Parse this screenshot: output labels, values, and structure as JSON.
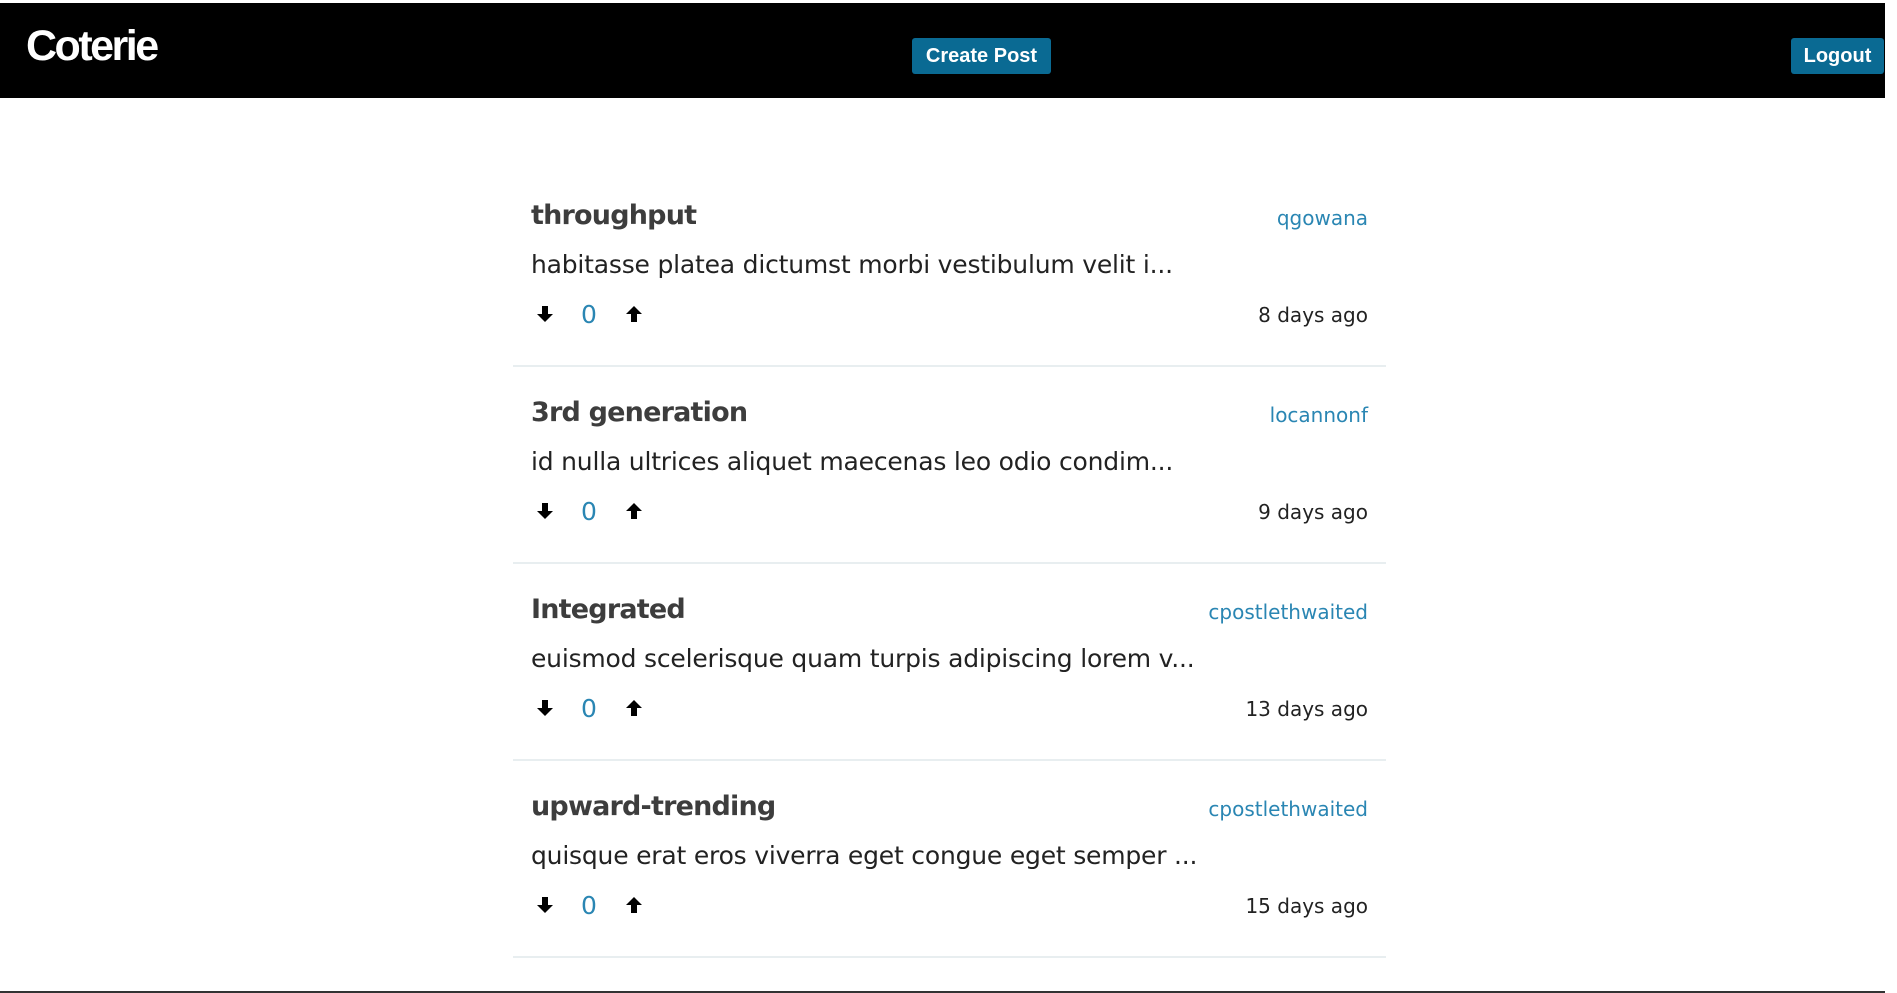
{
  "app": {
    "brand": "Coterie"
  },
  "header": {
    "create_label": "Create Post",
    "logout_label": "Logout"
  },
  "colors": {
    "navbar_bg": "#000000",
    "button_bg": "#0a6a93",
    "link": "#2a86b3"
  },
  "icons": {
    "downvote": "arrow-down-icon",
    "upvote": "arrow-up-icon"
  },
  "posts": [
    {
      "title": "throughput",
      "author": "qgowana",
      "excerpt": "habitasse platea dictumst morbi vestibulum velit i...",
      "votes": "0",
      "time": "8 days ago"
    },
    {
      "title": "3rd generation",
      "author": "locannonf",
      "excerpt": "id nulla ultrices aliquet maecenas leo odio condim...",
      "votes": "0",
      "time": "9 days ago"
    },
    {
      "title": "Integrated",
      "author": "cpostlethwaited",
      "excerpt": "euismod scelerisque quam turpis adipiscing lorem v...",
      "votes": "0",
      "time": "13 days ago"
    },
    {
      "title": "upward-trending",
      "author": "cpostlethwaited",
      "excerpt": "quisque erat eros viverra eget congue eget semper ...",
      "votes": "0",
      "time": "15 days ago"
    }
  ]
}
